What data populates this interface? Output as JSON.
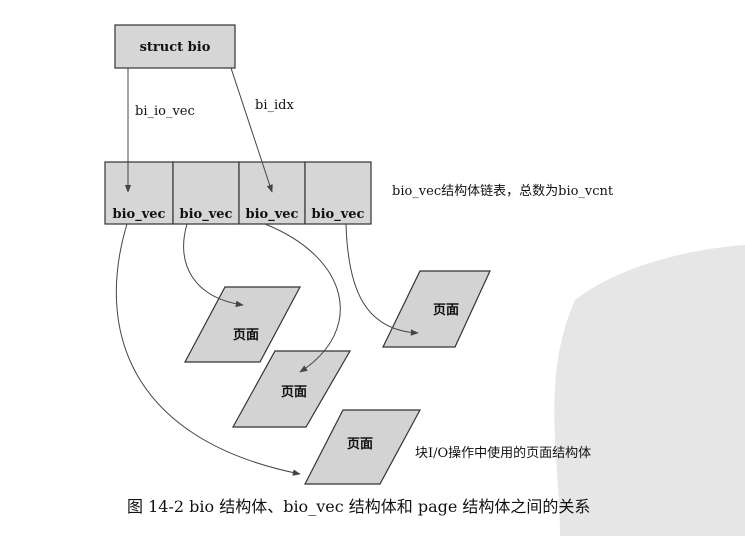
{
  "diagram": {
    "struct_bio": "struct bio",
    "edge_io_vec": "bi_io_vec",
    "edge_idx": "bi_idx",
    "vec_cells": [
      "bio_vec",
      "bio_vec",
      "bio_vec",
      "bio_vec"
    ],
    "vec_note": "bio_vec结构体链表，总数为bio_vcnt",
    "pages": [
      "页面",
      "页面",
      "页面",
      "页面"
    ],
    "page_note": "块I/O操作中使用的页面结构体"
  },
  "caption": "图 14-2   bio 结构体、bio_vec 结构体和 page 结构体之间的关系",
  "colors": {
    "fill": "#d6d6d6",
    "stroke": "#333333",
    "edge": "#444444"
  }
}
